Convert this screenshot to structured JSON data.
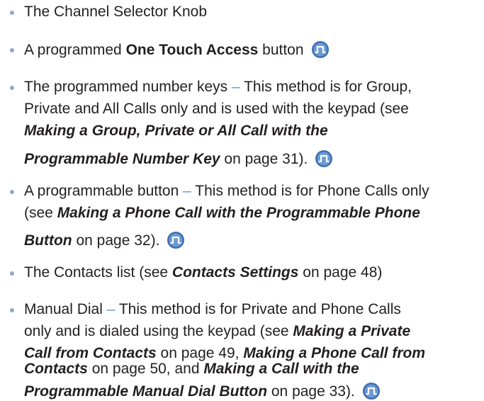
{
  "items": [
    {
      "line1": {
        "text": "The Channel Selector Knob"
      }
    },
    {
      "line1": {
        "pre": "A programmed ",
        "bold": "One Touch Access",
        "post": " button"
      },
      "icon": "motorola-programmable-button-icon"
    },
    {
      "line1": {
        "lead": "The programmed number keys",
        "dash": " – ",
        "rest": "This method is for Group,"
      },
      "line2": "Private and All Calls only and is used with the keypad (see",
      "line3": "Making a Group, Private or All Call with the",
      "line4": {
        "bolditalic": "Programmable Number Key",
        "post": " on page 31)."
      },
      "icon": "motorola-programmable-button-icon"
    },
    {
      "line1": {
        "lead": "A programmable button",
        "dash": " – ",
        "rest": "This method is for Phone Calls only"
      },
      "line2": {
        "pre": "(see ",
        "bolditalic": "Making a Phone Call with the Programmable Phone"
      },
      "line3": {
        "bolditalic": "Button",
        "post": " on page 32)."
      },
      "icon": "motorola-programmable-button-icon"
    },
    {
      "line1": {
        "pre": "The Contacts list (see ",
        "bolditalic": "Contacts Settings",
        "post": " on page 48)"
      }
    },
    {
      "line1": {
        "lead": "Manual Dial",
        "dash": " – ",
        "rest": "This method is for Private and Phone Calls"
      },
      "line2": {
        "pre": "only and is dialed using the keypad (see ",
        "bolditalic": "Making a Private"
      },
      "line3": {
        "bolditalic1": "Call from Contacts",
        "mid": " on page 49, ",
        "bolditalic2": "Making a Phone Call from"
      },
      "line4": {
        "bolditalic1": "Contacts",
        "mid": " on page 50, and ",
        "bolditalic2": "Making a Call with the"
      },
      "line5": {
        "bolditalic": "Programmable Manual Dial Button",
        "post": " on page 33)."
      },
      "icon": "motorola-programmable-button-icon"
    }
  ],
  "colors": {
    "text": "#231f20",
    "bullet": "#8fa9c8",
    "dash": "#6f93c4",
    "icon_fill": "#3f6fb0"
  }
}
